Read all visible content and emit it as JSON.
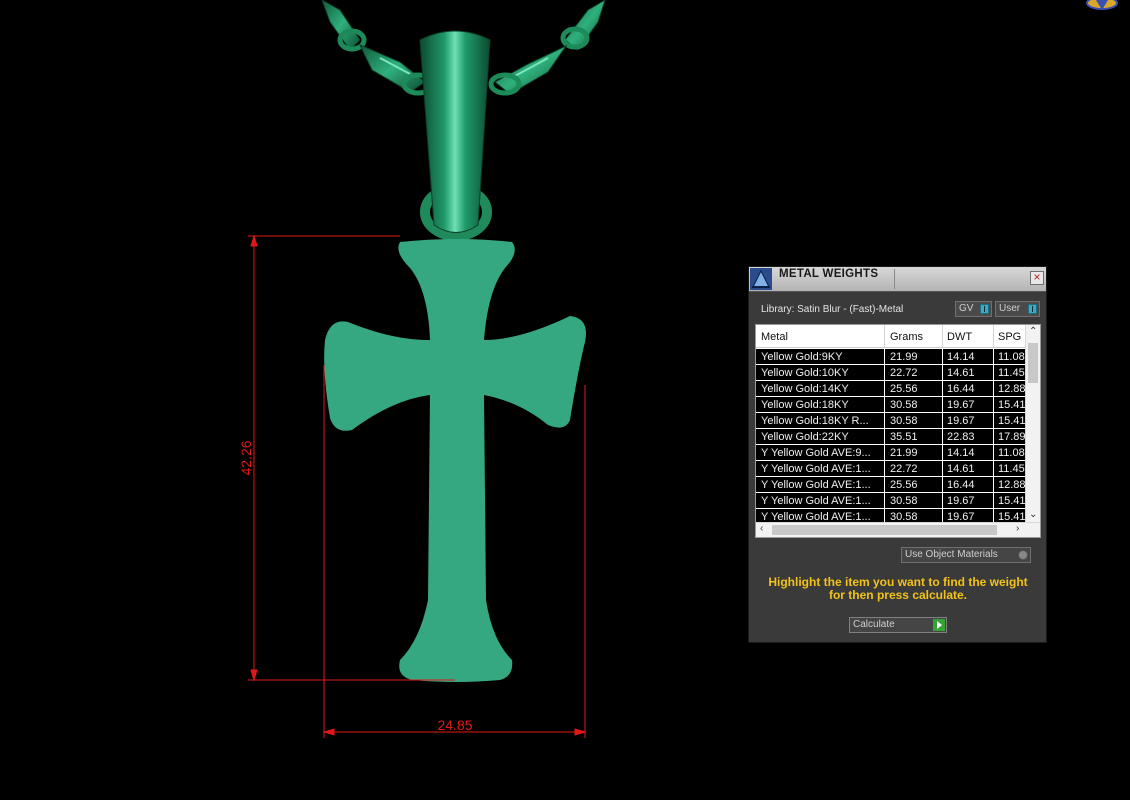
{
  "viewport": {
    "dimension_height": "42.26",
    "dimension_width": "24.85"
  },
  "panel": {
    "title": "METAL WEIGHTS",
    "close_label": "×",
    "library": "Library: Satin Blur - (Fast)-Metal",
    "toggles": {
      "gv": "GV",
      "user": "User"
    },
    "columns": [
      "Metal",
      "Grams",
      "DWT",
      "SPG"
    ],
    "rows": [
      [
        "Yellow Gold:9KY",
        "21.99",
        "14.14",
        "11.08"
      ],
      [
        "Yellow Gold:10KY",
        "22.72",
        "14.61",
        "11.45"
      ],
      [
        "Yellow Gold:14KY",
        "25.56",
        "16.44",
        "12.88"
      ],
      [
        "Yellow Gold:18KY",
        "30.58",
        "19.67",
        "15.41"
      ],
      [
        "Yellow Gold:18KY R...",
        "30.58",
        "19.67",
        "15.41"
      ],
      [
        "Yellow Gold:22KY",
        "35.51",
        "22.83",
        "17.89"
      ],
      [
        "Y Yellow Gold AVE:9...",
        "21.99",
        "14.14",
        "11.08"
      ],
      [
        "Y Yellow Gold AVE:1...",
        "22.72",
        "14.61",
        "11.45"
      ],
      [
        "Y Yellow Gold AVE:1...",
        "25.56",
        "16.44",
        "12.88"
      ],
      [
        "Y Yellow Gold AVE:1...",
        "30.58",
        "19.67",
        "15.41"
      ],
      [
        "Y Yellow Gold AVE:1...",
        "30.58",
        "19.67",
        "15.41"
      ]
    ],
    "use_object_materials": "Use Object Materials",
    "hint": "Highlight the item you want to find the weight for then press calculate.",
    "calculate": "Calculate"
  },
  "colors": {
    "model": "#35a882",
    "chain": "#1f8a5c",
    "dimension": "#e01818",
    "hint": "#f2c21a"
  }
}
